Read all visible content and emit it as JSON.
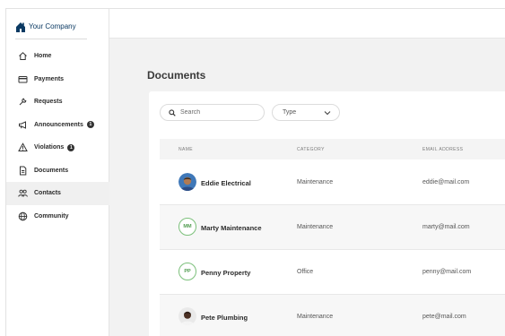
{
  "brand": {
    "name": "Your Company"
  },
  "sidebar": {
    "items": [
      {
        "label": "Home",
        "icon": "home-icon"
      },
      {
        "label": "Payments",
        "icon": "credit-card-icon"
      },
      {
        "label": "Requests",
        "icon": "wrench-icon"
      },
      {
        "label": "Announcements",
        "icon": "megaphone-icon",
        "badge": "1"
      },
      {
        "label": "Violations",
        "icon": "warning-icon",
        "badge": "1"
      },
      {
        "label": "Documents",
        "icon": "document-icon"
      },
      {
        "label": "Contacts",
        "icon": "people-icon",
        "active": true
      },
      {
        "label": "Community",
        "icon": "globe-icon"
      }
    ]
  },
  "main": {
    "title": "Documents",
    "search": {
      "placeholder": "Search"
    },
    "type_filter": {
      "value": "Type"
    },
    "table": {
      "columns": [
        "NAME",
        "CATEGORY",
        "EMAIL ADDRESS"
      ],
      "rows": [
        {
          "name": "Eddie Electrical",
          "category": "Maintenance",
          "email": "eddie@mail.com",
          "avatar": "photo"
        },
        {
          "name": "Marty Maintenance",
          "category": "Maintenance",
          "email": "marty@mail.com",
          "initials": "MM"
        },
        {
          "name": "Penny Property",
          "category": "Office",
          "email": "penny@mail.com",
          "initials": "PP"
        },
        {
          "name": "Pete Plumbing",
          "category": "Maintenance",
          "email": "pete@mail.com",
          "avatar": "photo"
        }
      ]
    }
  },
  "colors": {
    "brand": "#0b3a63",
    "initials_ring": "#7cc07b",
    "active_nav": "#f0f0f0"
  }
}
